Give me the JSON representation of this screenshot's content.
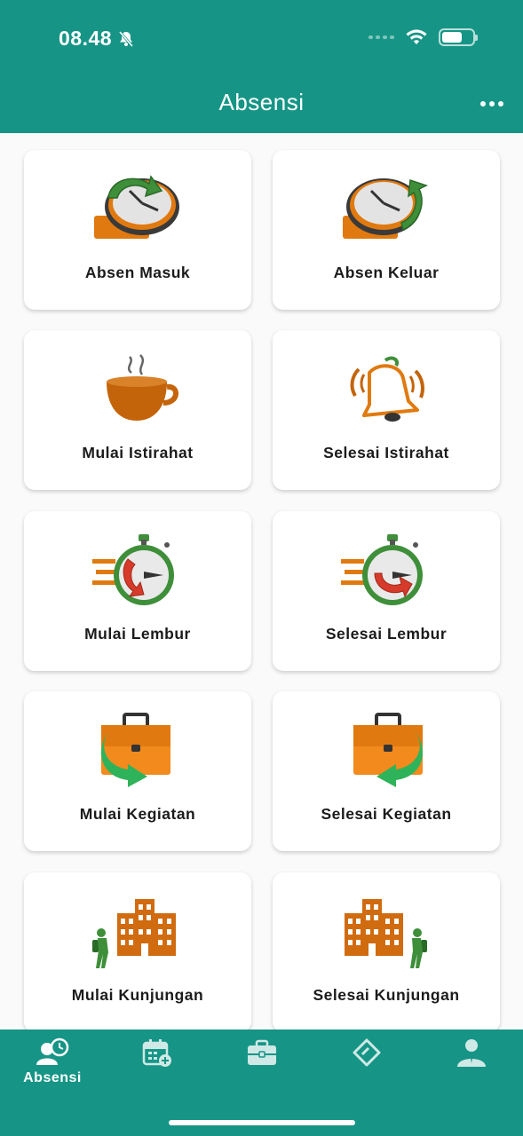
{
  "status_bar": {
    "time": "08.48"
  },
  "header": {
    "title": "Absensi"
  },
  "cards": [
    {
      "label": "Absen Masuk",
      "icon": "clock-in-icon"
    },
    {
      "label": "Absen Keluar",
      "icon": "clock-out-icon"
    },
    {
      "label": "Mulai Istirahat",
      "icon": "coffee-cup-icon"
    },
    {
      "label": "Selesai Istirahat",
      "icon": "ringing-bell-icon"
    },
    {
      "label": "Mulai Lembur",
      "icon": "stopwatch-overtime-start-icon"
    },
    {
      "label": "Selesai Lembur",
      "icon": "stopwatch-overtime-end-icon"
    },
    {
      "label": "Mulai Kegiatan",
      "icon": "briefcase-arrow-right-icon"
    },
    {
      "label": "Selesai Kegiatan",
      "icon": "briefcase-arrow-left-icon"
    },
    {
      "label": "Mulai Kunjungan",
      "icon": "visitor-building-icon"
    },
    {
      "label": "Selesai Kunjungan",
      "icon": "building-visitor-icon"
    }
  ],
  "bottom_nav": {
    "items": [
      {
        "label": "Absensi",
        "icon": "user-clock-icon",
        "active": true
      },
      {
        "label": "",
        "icon": "calendar-add-icon"
      },
      {
        "label": "",
        "icon": "briefcase-icon"
      },
      {
        "label": "",
        "icon": "tag-icon"
      },
      {
        "label": "",
        "icon": "person-profile-icon"
      }
    ]
  },
  "colors": {
    "primary": "#169586",
    "orange": "#e07a10",
    "brown": "#c4640a",
    "green": "#3f8f3a",
    "bright_green": "#2fb35a",
    "red": "#d63a2a"
  }
}
